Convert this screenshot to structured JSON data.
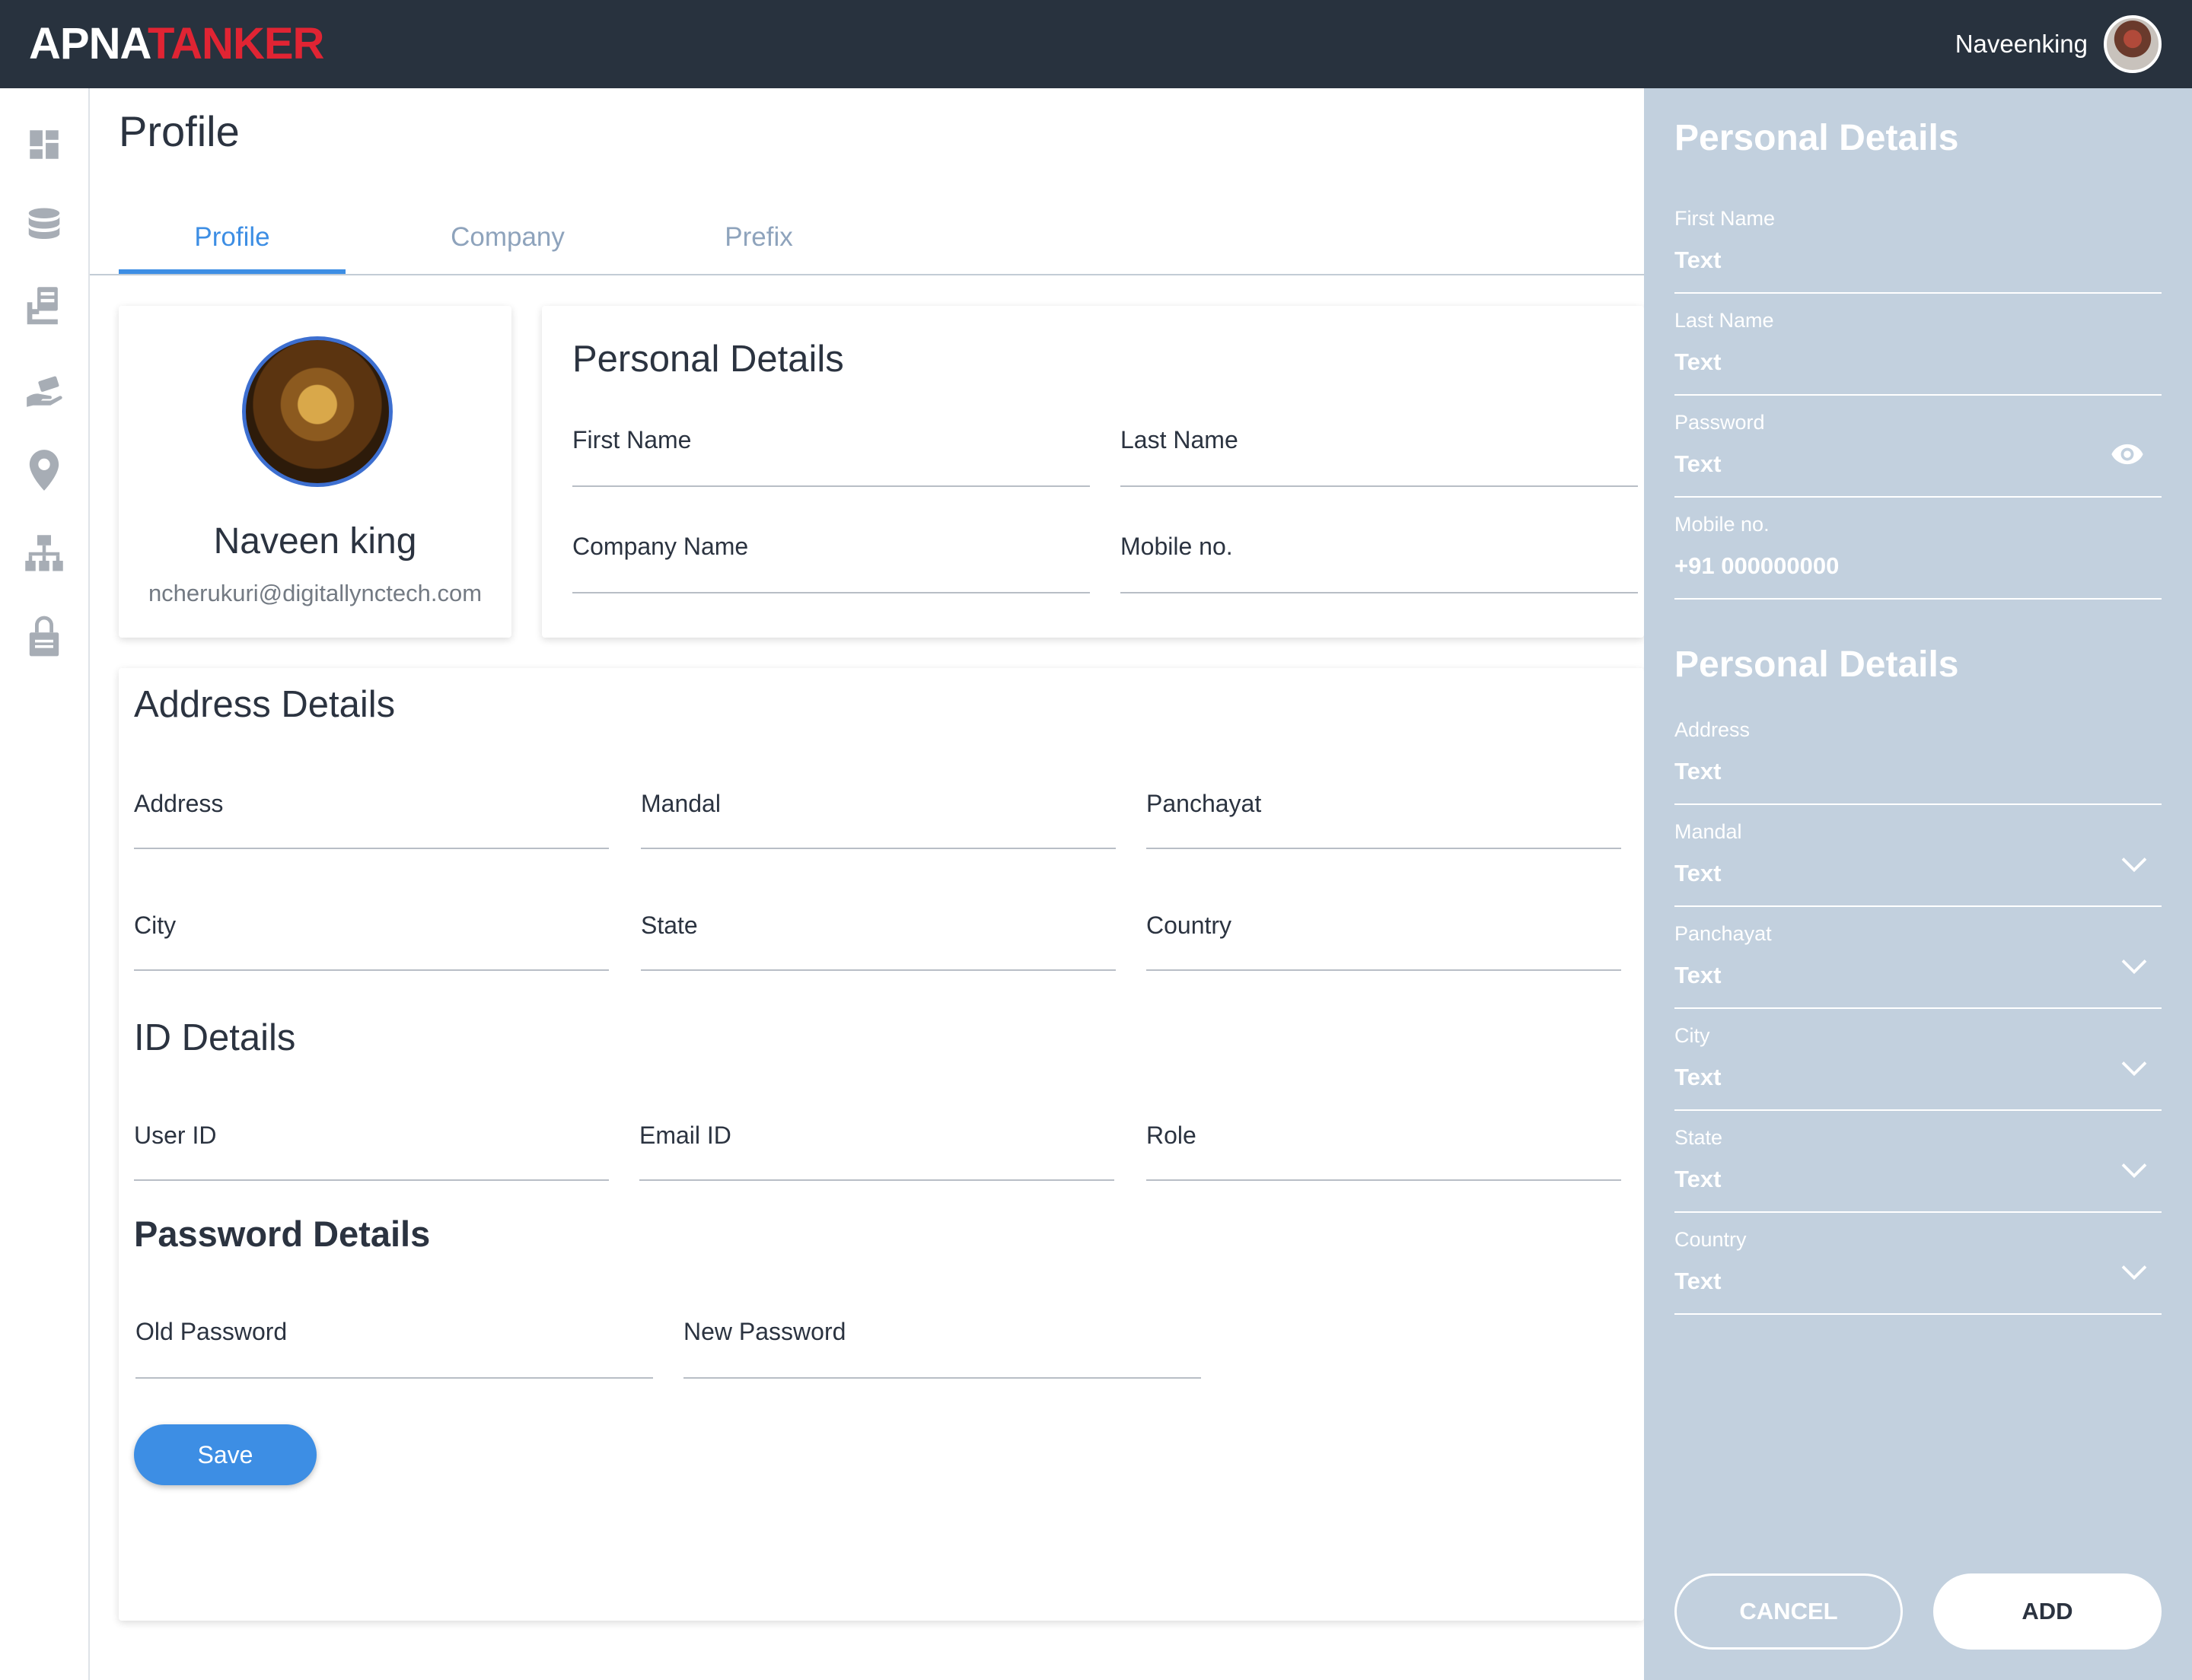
{
  "app": {
    "logo_part1": "APNA",
    "logo_part2": "TANKER",
    "username": "Naveenking"
  },
  "sidebar": {
    "items": [
      {
        "icon": "dashboard-icon"
      },
      {
        "icon": "database-icon"
      },
      {
        "icon": "clipboard-icon"
      },
      {
        "icon": "hand-money-icon"
      },
      {
        "icon": "location-pin-icon"
      },
      {
        "icon": "org-chart-icon"
      },
      {
        "icon": "lock-icon"
      }
    ]
  },
  "page": {
    "title": "Profile",
    "tabs": [
      {
        "label": "Profile",
        "active": true
      },
      {
        "label": "Company",
        "active": false
      },
      {
        "label": "Prefix",
        "active": false
      }
    ]
  },
  "profile_card": {
    "name": "Naveen king",
    "email": "ncherukuri@digitallynctech.com"
  },
  "personal_details": {
    "heading": "Personal Details",
    "first_name": "First Name",
    "last_name": "Last Name",
    "company_name": "Company Name",
    "mobile": "Mobile no."
  },
  "address_details": {
    "heading": "Address Details",
    "address": "Address",
    "mandal": "Mandal",
    "panchayat": "Panchayat",
    "city": "City",
    "state": "State",
    "country": "Country"
  },
  "id_details": {
    "heading": "ID Details",
    "user_id": "User ID",
    "email_id": "Email ID",
    "role": "Role"
  },
  "password_details": {
    "heading": "Password Details",
    "old_password": "Old Password",
    "new_password": "New Password",
    "save": "Save"
  },
  "right_panel": {
    "section1_heading": "Personal Details",
    "section1_fields": [
      {
        "label": "First Name",
        "value": "Text"
      },
      {
        "label": "Last Name",
        "value": "Text"
      },
      {
        "label": "Password",
        "value": "Text"
      },
      {
        "label": "Mobile no.",
        "value": "+91 000000000"
      }
    ],
    "section2_heading": "Personal Details",
    "section2_fields": [
      {
        "label": "Address",
        "value": "Text"
      },
      {
        "label": "Mandal",
        "value": "Text"
      },
      {
        "label": "Panchayat",
        "value": "Text"
      },
      {
        "label": "City",
        "value": "Text"
      },
      {
        "label": "State",
        "value": "Text"
      },
      {
        "label": "Country",
        "value": "Text"
      }
    ],
    "cancel": "CANCEL",
    "add": "ADD"
  },
  "colors": {
    "topbar": "#28323e",
    "brand_red": "#e02433",
    "accent_blue": "#3d8ee4",
    "panel_bg": "#c2d0de"
  }
}
